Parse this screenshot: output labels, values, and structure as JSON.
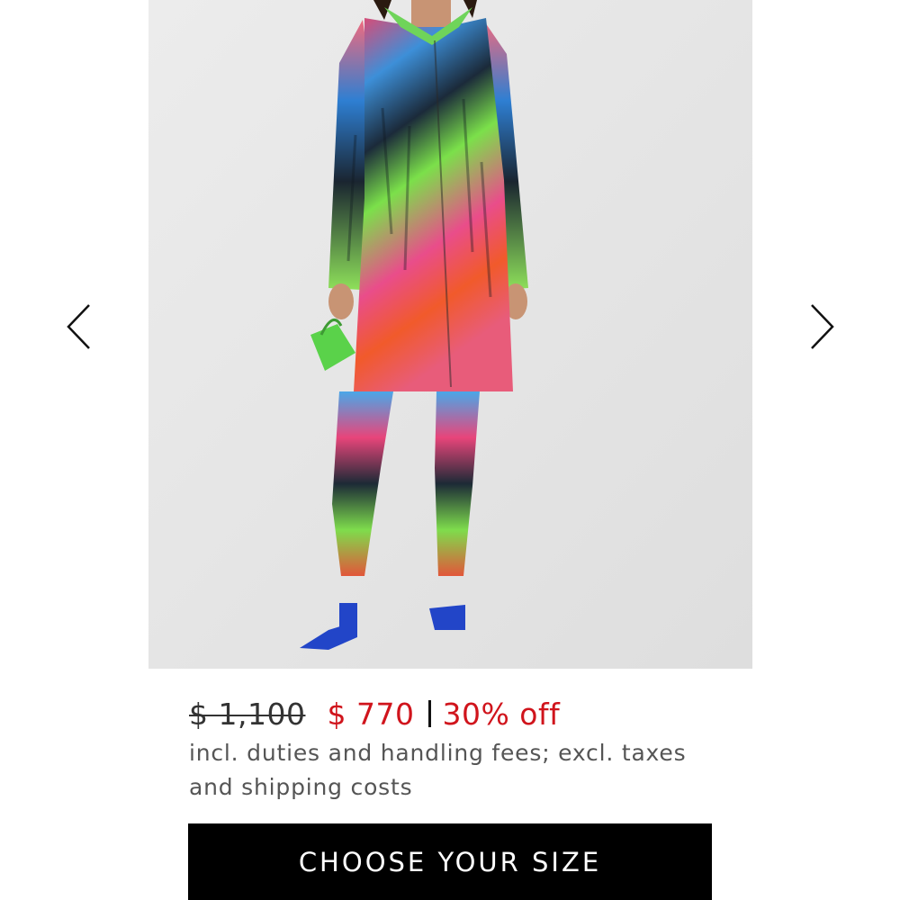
{
  "gallery": {
    "prev_icon": "chevron-left-icon",
    "next_icon": "chevron-right-icon"
  },
  "pricing": {
    "original_price": "$ 1,100",
    "sale_price": "$ 770",
    "separator": "|",
    "discount": "30% off",
    "note": "incl. duties and handling fees; excl. taxes and shipping costs"
  },
  "cta": {
    "label": "CHOOSE YOUR SIZE"
  },
  "colors": {
    "sale_red": "#d0141c",
    "button_bg": "#000000",
    "button_text": "#ffffff",
    "photo_bg": "#e8e8e8"
  }
}
